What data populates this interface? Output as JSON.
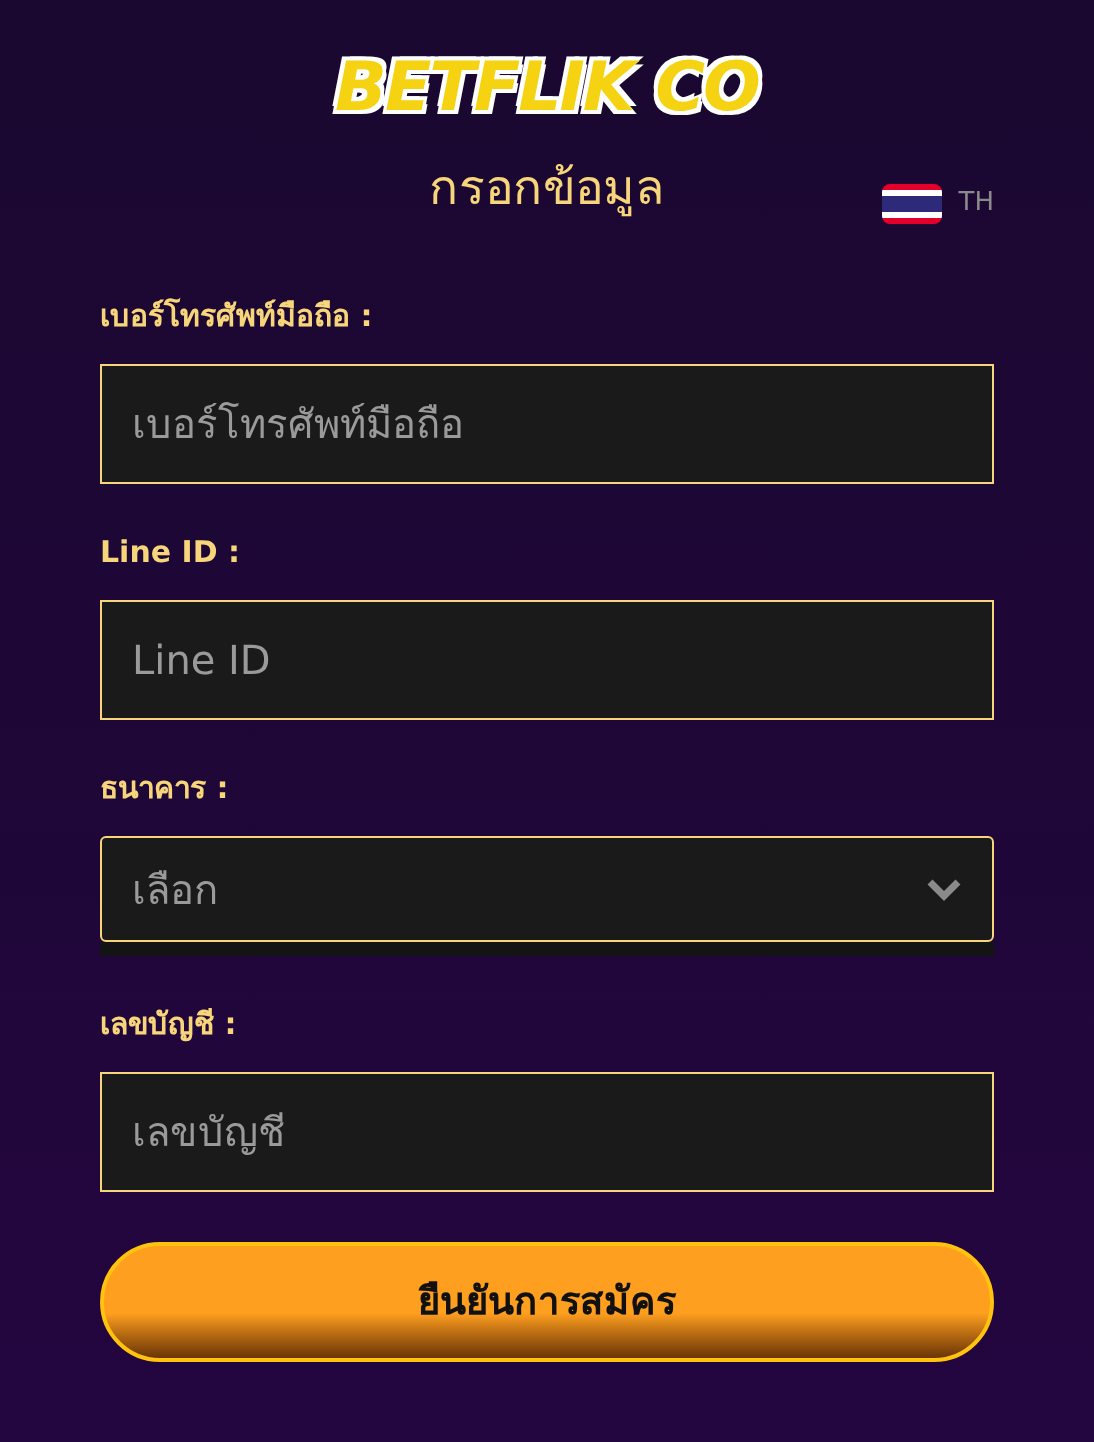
{
  "logo": "BETFLIK CO",
  "title": "กรอกข้อมูล",
  "language": {
    "code": "TH"
  },
  "fields": [
    {
      "kind": "text",
      "label": "เบอร์โทรศัพท์มือถือ :",
      "placeholder": "เบอร์โทรศัพท์มือถือ"
    },
    {
      "kind": "text",
      "label": "Line ID :",
      "placeholder": "Line ID"
    },
    {
      "kind": "select",
      "label": "ธนาคาร :",
      "value": "เลือก"
    },
    {
      "kind": "text",
      "label": "เลขบัญชี :",
      "placeholder": "เลขบัญชี"
    }
  ],
  "submit": "ยืนยันการสมัคร"
}
